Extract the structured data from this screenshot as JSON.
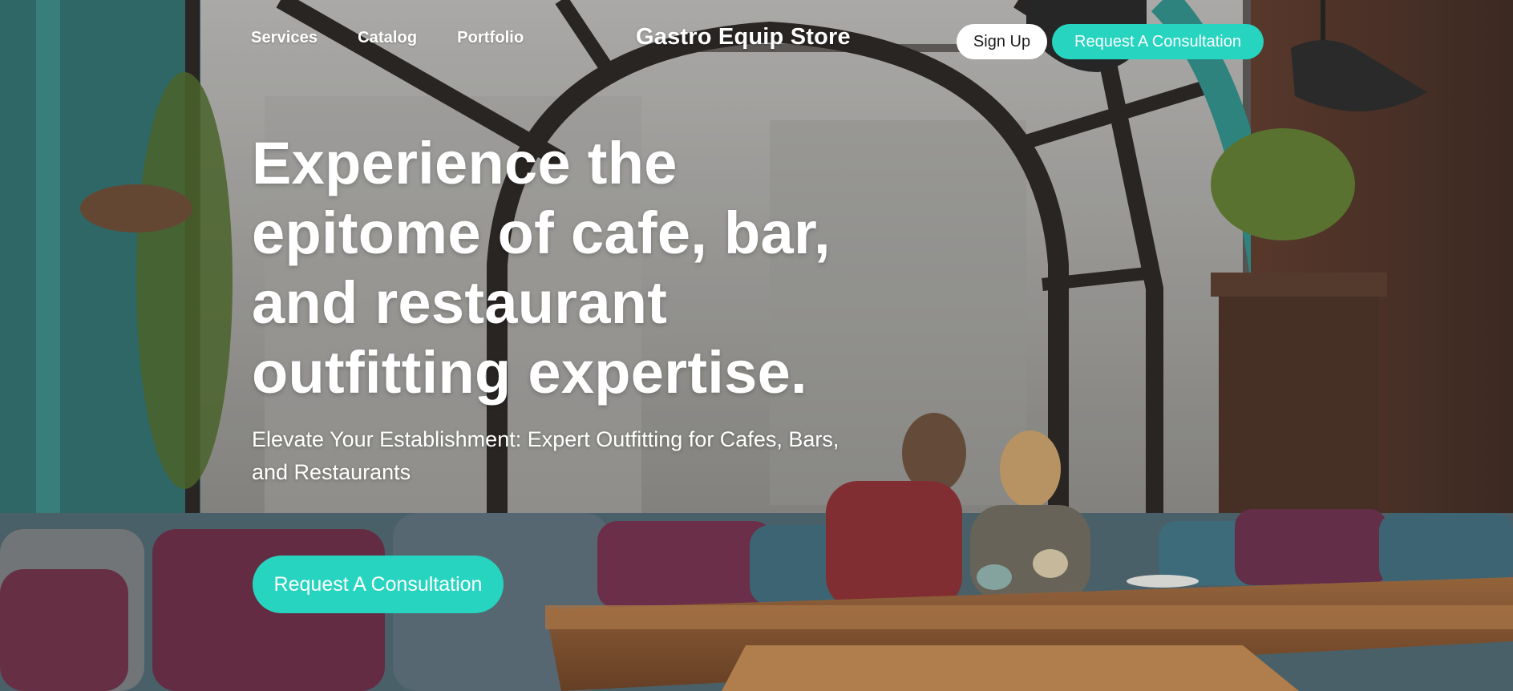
{
  "header": {
    "nav": [
      "Services",
      "Catalog",
      "Portfolio"
    ],
    "brand": "Gastro Equip Store",
    "signup_label": "Sign Up",
    "consult_label": "Request A Consultation"
  },
  "hero": {
    "title": "Experience the epitome of cafe, bar, and restaurant outfitting expertise.",
    "subtitle": "Elevate Your Establishment: Expert Outfitting for Cafes, Bars, and Restaurants",
    "cta_label": "Request A Consultation"
  },
  "colors": {
    "accent": "#27d4bf",
    "text": "#ffffff",
    "button_light": "#ffffff"
  }
}
